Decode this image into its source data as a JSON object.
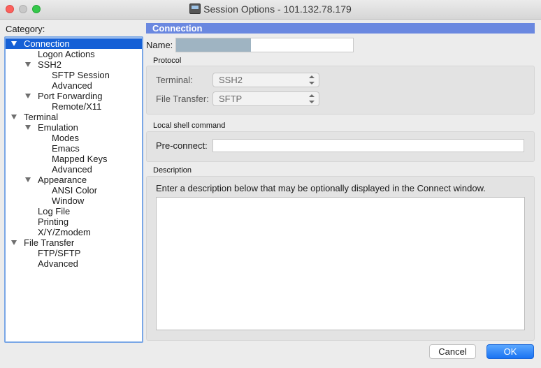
{
  "window": {
    "title": "Session Options - 101.132.78.179",
    "app_icon": "securecrt-app-icon"
  },
  "category": {
    "label": "Category:",
    "tree": [
      {
        "label": "Connection",
        "level": 0,
        "expanded": true,
        "selected": true
      },
      {
        "label": "Logon Actions",
        "level": 1
      },
      {
        "label": "SSH2",
        "level": 1,
        "expanded": true
      },
      {
        "label": "SFTP Session",
        "level": 2
      },
      {
        "label": "Advanced",
        "level": 2
      },
      {
        "label": "Port Forwarding",
        "level": 1,
        "expanded": true
      },
      {
        "label": "Remote/X11",
        "level": 2
      },
      {
        "label": "Terminal",
        "level": 0,
        "expanded": true
      },
      {
        "label": "Emulation",
        "level": 1,
        "expanded": true
      },
      {
        "label": "Modes",
        "level": 2
      },
      {
        "label": "Emacs",
        "level": 2
      },
      {
        "label": "Mapped Keys",
        "level": 2
      },
      {
        "label": "Advanced",
        "level": 2
      },
      {
        "label": "Appearance",
        "level": 1,
        "expanded": true
      },
      {
        "label": "ANSI Color",
        "level": 2
      },
      {
        "label": "Window",
        "level": 2
      },
      {
        "label": "Log File",
        "level": 1
      },
      {
        "label": "Printing",
        "level": 1
      },
      {
        "label": "X/Y/Zmodem",
        "level": 1
      },
      {
        "label": "File Transfer",
        "level": 0,
        "expanded": true
      },
      {
        "label": "FTP/SFTP",
        "level": 1
      },
      {
        "label": "Advanced",
        "level": 1
      }
    ]
  },
  "main": {
    "header": "Connection",
    "name_label": "Name:",
    "name_value": "",
    "protocol": {
      "title": "Protocol",
      "terminal_label": "Terminal:",
      "terminal_value": "SSH2",
      "file_transfer_label": "File Transfer:",
      "file_transfer_value": "SFTP"
    },
    "local_shell": {
      "title": "Local shell command",
      "preconnect_label": "Pre-connect:",
      "preconnect_value": ""
    },
    "description": {
      "title": "Description",
      "help_text": "Enter a description below that may be optionally displayed in the Connect window.",
      "value": ""
    }
  },
  "buttons": {
    "cancel": "Cancel",
    "ok": "OK"
  },
  "colors": {
    "selection": "#1560d6",
    "header_bar": "#6a88e0",
    "ok_button": "#1a73f2",
    "tree_focus_border": "#7aa7e6"
  }
}
